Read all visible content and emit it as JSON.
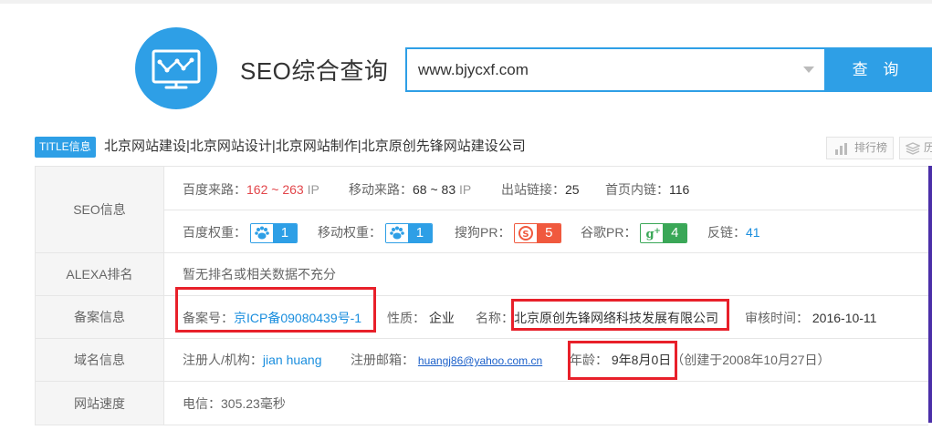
{
  "header": {
    "app_title": "SEO综合查询",
    "search_value": "www.bjycxf.com",
    "search_button": "查 询"
  },
  "title_row": {
    "badge": "TITLE信息",
    "title": "北京网站建设|北京网站设计|北京网站制作|北京原创先锋网站建设公司",
    "rank_button": "排行榜",
    "extra_button": "历"
  },
  "seo": {
    "label": "SEO信息",
    "baidu_traffic_label": "百度来路：",
    "baidu_traffic_value": "162 ~ 263",
    "baidu_traffic_unit": "IP",
    "mobile_traffic_label": "移动来路：",
    "mobile_traffic_value": "68 ~ 83",
    "mobile_traffic_unit": "IP",
    "outlinks_label": "出站链接：",
    "outlinks_value": "25",
    "homepage_links_label": "首页内链：",
    "homepage_links_value": "116",
    "baidu_weight_label": "百度权重：",
    "baidu_weight_value": "1",
    "mobile_weight_label": "移动权重：",
    "mobile_weight_value": "1",
    "sogou_pr_label": "搜狗PR：",
    "sogou_pr_value": "5",
    "google_pr_label": "谷歌PR：",
    "google_pr_value": "4",
    "backlinks_label": "反链：",
    "backlinks_value": "41"
  },
  "alexa": {
    "label": "ALEXA排名",
    "value": "暂无排名或相关数据不充分"
  },
  "icp": {
    "label": "备案信息",
    "number_label": "备案号：",
    "number_value": "京ICP备09080439号-1",
    "nature_label": "性质：",
    "nature_value": "企业",
    "name_label": "名称：",
    "name_value": "北京原创先锋网络科技发展有限公司",
    "audit_label": "审核时间：",
    "audit_value": "2016-10-11"
  },
  "domain": {
    "label": "域名信息",
    "registrant_label": "注册人/机构：",
    "registrant_value": "jian huang",
    "email_label": "注册邮箱：",
    "email_value": "huangj86@yahoo.com.cn",
    "age_label": "年龄：",
    "age_value": "9年8月0日",
    "created_text": "（创建于2008年10月27日）"
  },
  "speed": {
    "label": "网站速度",
    "value": "电信：305.23毫秒"
  },
  "colors": {
    "accent": "#2e9fe6",
    "highlight": "#e8202a",
    "sogou": "#f0593e",
    "google": "#3aa757",
    "baidu": "#2e9fe6"
  },
  "icons": [
    "monitor-chart-logo-icon",
    "dropdown-caret-icon",
    "bar-chart-icon",
    "stack-icon",
    "baidu-paw-icon",
    "sogou-icon",
    "google-plus-icon"
  ]
}
